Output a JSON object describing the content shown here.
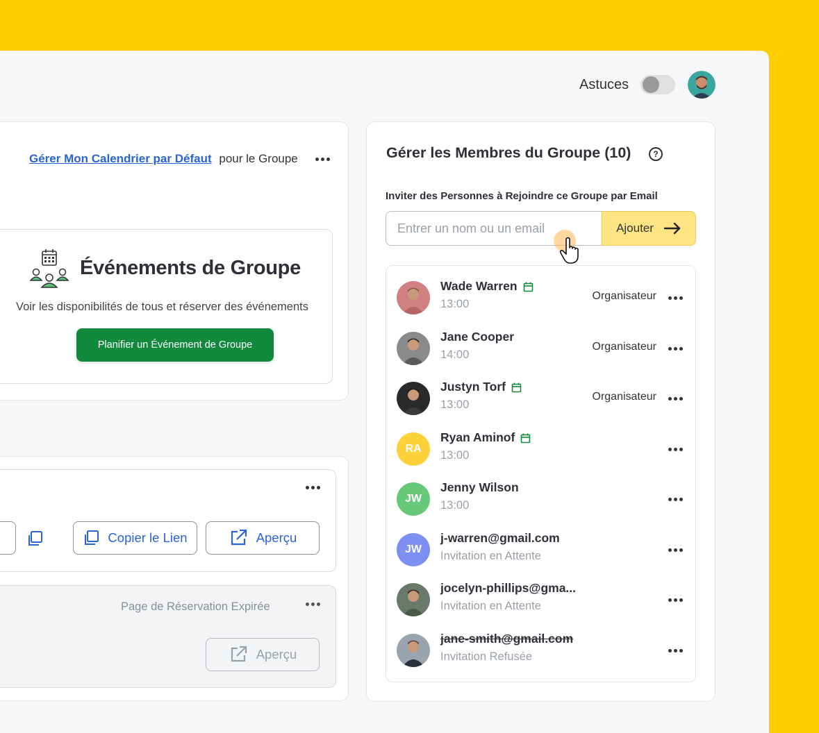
{
  "header": {
    "tips_label": "Astuces",
    "tips_enabled": false
  },
  "calendar": {
    "link_label": "Gérer Mon Calendrier par Défaut",
    "suffix": "pour le Groupe"
  },
  "group_events": {
    "title": "Événements de Groupe",
    "subtitle": "Voir les disponibilités de tous et réserver des événements",
    "plan_button": "Planifier un Événement de Groupe"
  },
  "booking": {
    "copy_link_button": "Copier le Lien",
    "preview_button": "Aperçu",
    "expired_label": "Page de Réservation Expirée",
    "expired_preview_button": "Aperçu"
  },
  "members": {
    "title": "Gérer les Membres du Groupe (10)",
    "help_glyph": "?",
    "invite_label": "Inviter des Personnes à Rejoindre ce Groupe par Email",
    "invite_placeholder": "Entrer un nom ou un email",
    "add_button": "Ajouter",
    "list": [
      {
        "name": "Wade Warren",
        "sub": "13:00",
        "role": "Organisateur",
        "calendar_icon": true,
        "avatar": "photo",
        "strike": false
      },
      {
        "name": "Jane Cooper",
        "sub": "14:00",
        "role": "Organisateur",
        "calendar_icon": false,
        "avatar": "photo",
        "strike": false
      },
      {
        "name": "Justyn Torf",
        "sub": "13:00",
        "role": "Organisateur",
        "calendar_icon": true,
        "avatar": "photo",
        "strike": false
      },
      {
        "name": "Ryan Aminof",
        "sub": "13:00",
        "role": "",
        "calendar_icon": true,
        "avatar": "RA",
        "avatar_color": "#fdd13a",
        "strike": false
      },
      {
        "name": "Jenny Wilson",
        "sub": "13:00",
        "role": "",
        "calendar_icon": false,
        "avatar": "JW",
        "avatar_color": "#66c97a",
        "strike": false
      },
      {
        "name": "j-warren@gmail.com",
        "sub": "Invitation en Attente",
        "role": "",
        "calendar_icon": false,
        "avatar": "JW",
        "avatar_color": "#7d8ff0",
        "strike": false
      },
      {
        "name": "jocelyn-phillips@gma...",
        "sub": "Invitation en Attente",
        "role": "",
        "calendar_icon": false,
        "avatar": "photo",
        "strike": false
      },
      {
        "name": "jane-smith@gmail.com",
        "sub": "Invitation Refusée",
        "role": "",
        "calendar_icon": false,
        "avatar": "photo",
        "strike": true
      }
    ]
  },
  "colors": {
    "background": "#ffcc00",
    "primary_green": "#118a3d",
    "link_blue": "#2864d6",
    "add_button_yellow": "#ffe484"
  }
}
